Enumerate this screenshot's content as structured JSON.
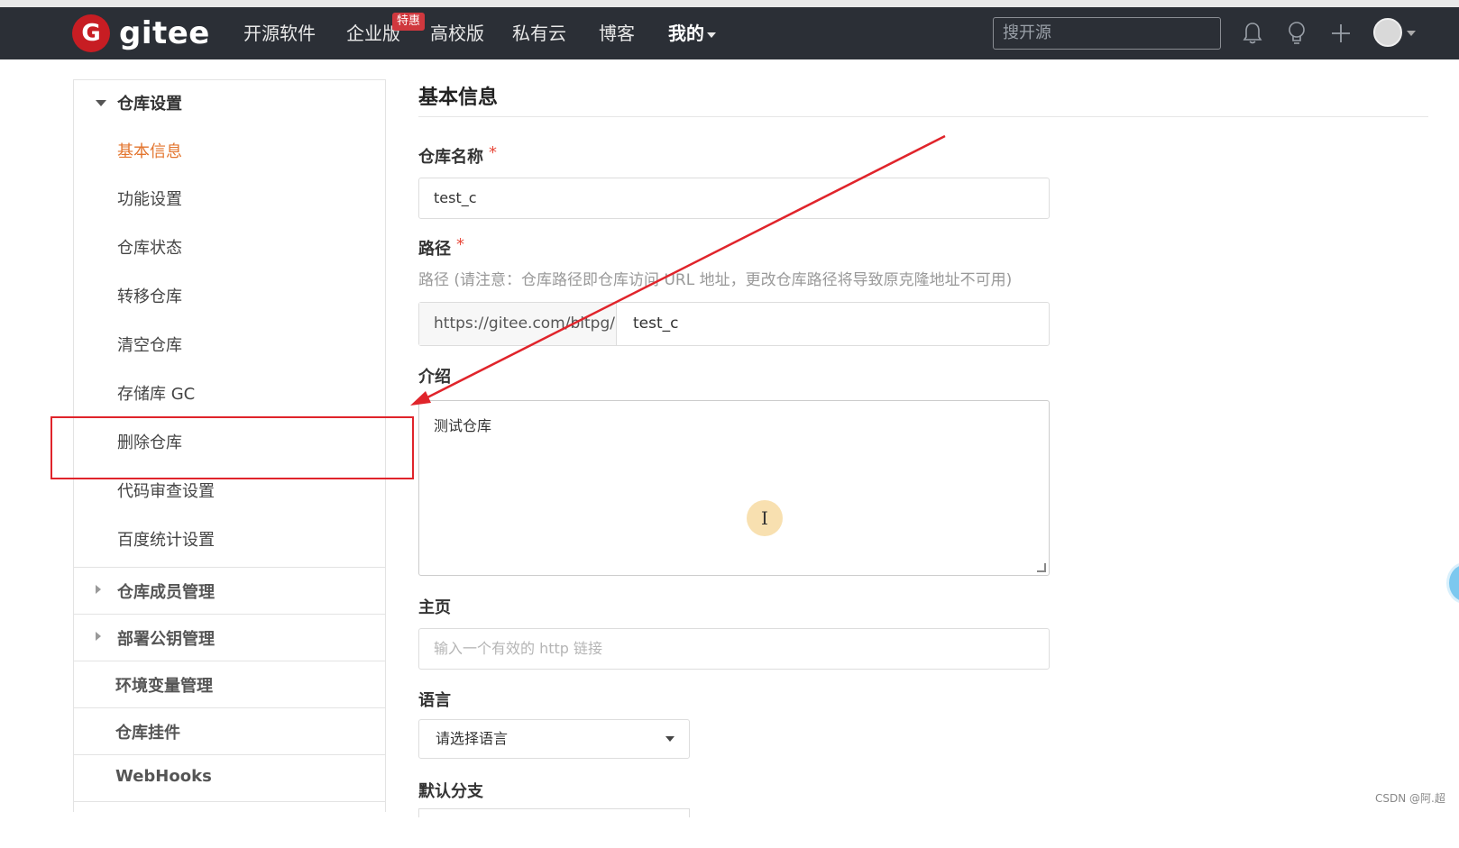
{
  "navbar": {
    "logo_text": "gitee",
    "logo_badge": "G",
    "items": [
      "开源软件",
      "企业版",
      "高校版",
      "私有云",
      "博客",
      "我的"
    ],
    "promo_badge": "特惠",
    "search_placeholder": "搜开源"
  },
  "sidebar": {
    "section_title": "仓库设置",
    "items": [
      "基本信息",
      "功能设置",
      "仓库状态",
      "转移仓库",
      "清空仓库",
      "存储库 GC",
      "删除仓库",
      "代码审查设置",
      "百度统计设置"
    ],
    "active_item": "基本信息",
    "groups": [
      "仓库成员管理",
      "部署公钥管理",
      "环境变量管理",
      "仓库挂件",
      "WebHooks"
    ]
  },
  "form": {
    "title": "基本信息",
    "repo_name_label": "仓库名称",
    "repo_name_value": "test_c",
    "required_mark": "*",
    "path_label": "路径",
    "path_hint": "路径 (请注意：仓库路径即仓库访问 URL 地址，更改仓库路径将导致原克隆地址不可用)",
    "path_prefix": "https://gitee.com/bitpg/",
    "path_value": "test_c",
    "intro_label": "介绍",
    "intro_value": "测试仓库",
    "homepage_label": "主页",
    "homepage_placeholder": "输入一个有效的 http 链接",
    "language_label": "语言",
    "language_value": "请选择语言",
    "default_branch_label": "默认分支"
  },
  "cursor_glyph": "I",
  "watermark": "CSDN @阿.超",
  "colors": {
    "navbar_bg": "#2b2f36",
    "brand_red": "#c71d23",
    "active_orange": "#e3752e",
    "annotation_red": "#e0242b"
  }
}
